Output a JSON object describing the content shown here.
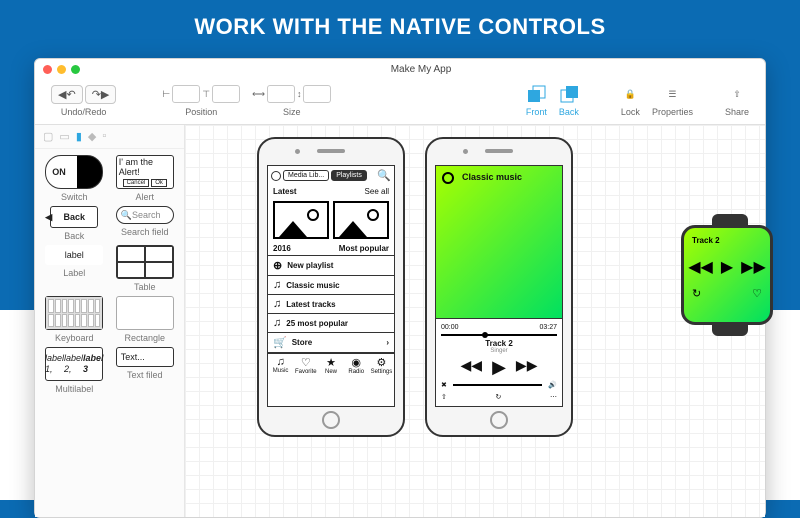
{
  "hero": "WORK WITH THE NATIVE CONTROLS",
  "window_title": "Make My App",
  "toolbar": {
    "undo_redo": "Undo/Redo",
    "position": "Position",
    "size": "Size",
    "front": "Front",
    "back": "Back",
    "lock": "Lock",
    "properties": "Properties",
    "share": "Share"
  },
  "palette": {
    "switch": {
      "on": "ON",
      "label": "Switch"
    },
    "alert": {
      "text": "I' am the Alert!",
      "cancel": "Cancel",
      "ok": "Ok",
      "label": "Alert"
    },
    "back": {
      "btn": "Back",
      "label": "Back"
    },
    "search": {
      "placeholder": "Search",
      "label": "Search field"
    },
    "label_w": {
      "text": "label",
      "label": "Label"
    },
    "table": {
      "label": "Table"
    },
    "keyboard": {
      "label": "Keyboard"
    },
    "rectangle": {
      "label": "Rectangle"
    },
    "multilabel": {
      "l1": "label 1,",
      "l2": "label 2,",
      "l3": "label 3",
      "label": "Multilabel"
    },
    "textfield": {
      "text": "Text...",
      "label": "Text filed"
    }
  },
  "phone1": {
    "seg": [
      "Media Lib...",
      "Playlists"
    ],
    "latest": "Latest",
    "see_all": "See all",
    "caption1": "2016",
    "caption2": "Most popular",
    "new_playlist": "New playlist",
    "items": [
      "Classic music",
      "Latest tracks",
      "25 most popular"
    ],
    "store": "Store",
    "tabs": [
      "Music",
      "Favorite",
      "New",
      "Radio",
      "Settings"
    ]
  },
  "phone2": {
    "cover_title": "Classic music",
    "time_elapsed": "00:00",
    "time_total": "03:27",
    "track": "Track 2",
    "artist": "Singer"
  },
  "watch": {
    "track": "Track 2"
  }
}
